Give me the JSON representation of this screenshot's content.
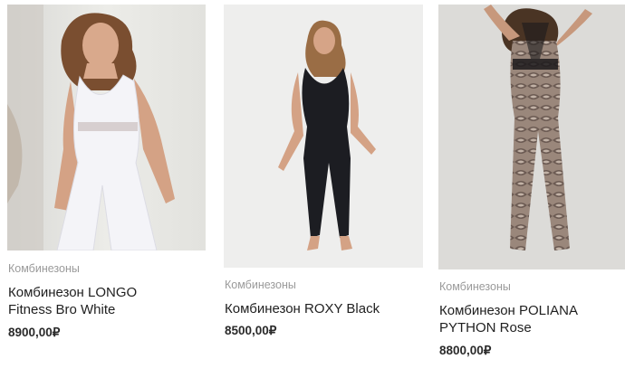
{
  "products": [
    {
      "category": "Комбинезоны",
      "title_line1": "Комбинезон LONGO",
      "title_line2": "Fitness Bro White",
      "price": "8900,00₽",
      "image": "white-jumpsuit-photo",
      "color": "#f2f2f6"
    },
    {
      "category": "Комбинезоны",
      "title_line1": "Комбинезон ROXY Black",
      "title_line2": "",
      "price": "8500,00₽",
      "image": "black-jumpsuit-photo",
      "color": "#1c1d22"
    },
    {
      "category": "Комбинезоны",
      "title_line1": "Комбинезон POLIANA",
      "title_line2": "PYTHON Rose",
      "price": "8800,00₽",
      "image": "python-print-jumpsuit-photo",
      "color": "#8c7a70"
    }
  ]
}
